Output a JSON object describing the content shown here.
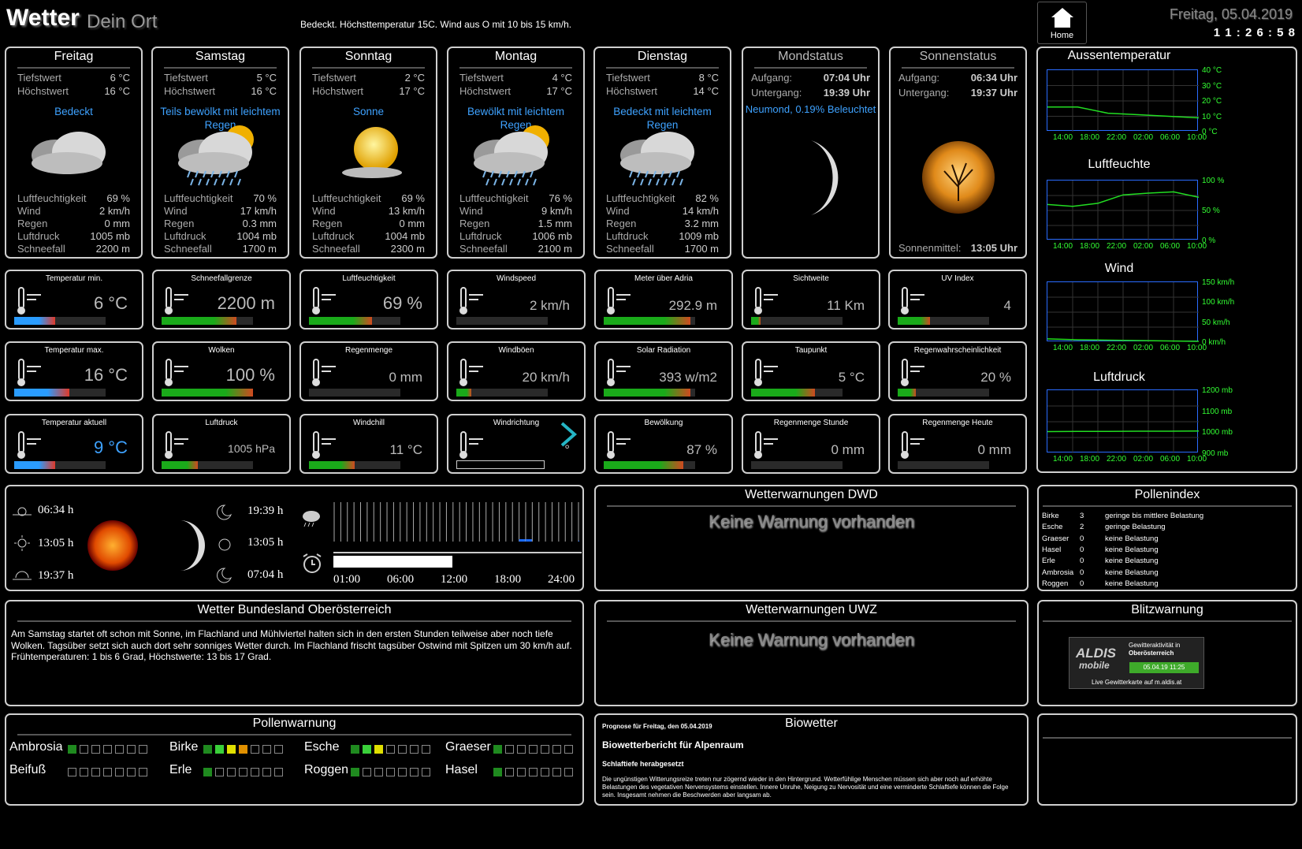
{
  "header": {
    "title": "Wetter",
    "subtitle": "Dein Ort",
    "summary": "Bedeckt. Höchsttemperatur 15C. Wind aus O mit 10 bis 15 km/h.",
    "home_label": "Home",
    "date": "Freitag, 05.04.2019",
    "time": "1 1 : 2 6 : 5 8"
  },
  "forecast": [
    {
      "day": "Freitag",
      "min_label": "Tiefstwert",
      "min": "6 °C",
      "max_label": "Höchstwert",
      "max": "16 °C",
      "desc": "Bedeckt",
      "icon": "cloudy-icon",
      "hum_label": "Luftfeuchtigkeit",
      "hum": "69 %",
      "wind_label": "Wind",
      "wind": "2 km/h",
      "rain_label": "Regen",
      "rain": "0 mm",
      "press_label": "Luftdruck",
      "press": "1005 mb",
      "snow_label": "Schneefall",
      "snow": "2200 m"
    },
    {
      "day": "Samstag",
      "min_label": "Tiefstwert",
      "min": "5 °C",
      "max_label": "Höchstwert",
      "max": "16 °C",
      "desc": "Teils bewölkt mit leichtem Regen",
      "icon": "sun-cloud-rain-icon",
      "hum_label": "Luftfeuchtigkeit",
      "hum": "70 %",
      "wind_label": "Wind",
      "wind": "17 km/h",
      "rain_label": "Regen",
      "rain": "0.3 mm",
      "press_label": "Luftdruck",
      "press": "1004 mb",
      "snow_label": "Schneefall",
      "snow": "1700 m"
    },
    {
      "day": "Sonntag",
      "min_label": "Tiefstwert",
      "min": "2 °C",
      "max_label": "Höchstwert",
      "max": "17 °C",
      "desc": "Sonne",
      "icon": "sun-icon",
      "hum_label": "Luftfeuchtigkeit",
      "hum": "69 %",
      "wind_label": "Wind",
      "wind": "13 km/h",
      "rain_label": "Regen",
      "rain": "0 mm",
      "press_label": "Luftdruck",
      "press": "1004 mb",
      "snow_label": "Schneefall",
      "snow": "2300 m"
    },
    {
      "day": "Montag",
      "min_label": "Tiefstwert",
      "min": "4 °C",
      "max_label": "Höchstwert",
      "max": "17 °C",
      "desc": "Bewölkt mit leichtem Regen",
      "icon": "sun-cloud-rain-icon",
      "hum_label": "Luftfeuchtigkeit",
      "hum": "76 %",
      "wind_label": "Wind",
      "wind": "9 km/h",
      "rain_label": "Regen",
      "rain": "1.5 mm",
      "press_label": "Luftdruck",
      "press": "1006 mb",
      "snow_label": "Schneefall",
      "snow": "2100 m"
    },
    {
      "day": "Dienstag",
      "min_label": "Tiefstwert",
      "min": "8 °C",
      "max_label": "Höchstwert",
      "max": "14 °C",
      "desc": "Bedeckt mit leichtem Regen",
      "icon": "cloud-rain-icon",
      "hum_label": "Luftfeuchtigkeit",
      "hum": "82 %",
      "wind_label": "Wind",
      "wind": "14 km/h",
      "rain_label": "Regen",
      "rain": "3.2 mm",
      "press_label": "Luftdruck",
      "press": "1009 mb",
      "snow_label": "Schneefall",
      "snow": "1700 m"
    }
  ],
  "moon": {
    "title": "Mondstatus",
    "rise_label": "Aufgang:",
    "rise": "07:04 Uhr",
    "set_label": "Untergang:",
    "set": "19:39 Uhr",
    "phase": "Neumond, 0.19% Beleuchtet"
  },
  "sun": {
    "title": "Sonnenstatus",
    "rise_label": "Aufgang:",
    "rise": "06:34 Uhr",
    "set_label": "Untergang:",
    "set": "19:37 Uhr",
    "noon_label": "Sonnenmittel:",
    "noon": "13:05 Uhr"
  },
  "sensors": [
    {
      "title": "Temperatur min.",
      "value": "6 °C",
      "icon": "thermometer-min-icon",
      "level": 0.45,
      "color": "blue"
    },
    {
      "title": "Schneefallgrenze",
      "value": "2200 m",
      "icon": "snowflake-icon",
      "level": 0.82,
      "color": "green"
    },
    {
      "title": "Luftfeuchtigkeit",
      "value": "69 %",
      "icon": "humidity-icon",
      "level": 0.69,
      "color": "green"
    },
    {
      "title": "Windspeed",
      "value": "2 km/h",
      "icon": "windsock-icon",
      "level": 0.0,
      "color": "green"
    },
    {
      "title": "Meter über Adria",
      "value": "292.9 m",
      "icon": "altitude-icon",
      "level": 0.95,
      "color": "green"
    },
    {
      "title": "Sichtweite",
      "value": "11 Km",
      "icon": "visibility-icon",
      "level": 0.1,
      "color": "green"
    },
    {
      "title": "UV Index",
      "value": "4",
      "icon": "uv-index-icon",
      "level": 0.35,
      "color": "green"
    },
    {
      "title": "Temperatur max.",
      "value": "16 °C",
      "icon": "thermometer-max-icon",
      "level": 0.6,
      "color": "blue"
    },
    {
      "title": "Wolken",
      "value": "100 %",
      "icon": "cloud-sun-icon",
      "level": 1.0,
      "color": "green"
    },
    {
      "title": "Regenmenge",
      "value": "0 mm",
      "icon": "rain-icon",
      "level": 0.0,
      "color": "green"
    },
    {
      "title": "Windböen",
      "value": "20 km/h",
      "icon": "windsock-bft-icon",
      "level": 0.16,
      "color": "green"
    },
    {
      "title": "Solar Radiation",
      "value": "393 w/m2",
      "icon": "solar-radiation-icon",
      "level": 0.95,
      "color": "green"
    },
    {
      "title": "Taupunkt",
      "value": "5 °C",
      "icon": "dewpoint-icon",
      "level": 0.7,
      "color": "green"
    },
    {
      "title": "Regenwahrscheinlichkeit",
      "value": "20 %",
      "icon": "rain-probability-icon",
      "level": 0.2,
      "color": "green"
    },
    {
      "title": "Temperatur aktuell",
      "value": "9 °C",
      "icon": "thermometer-icon",
      "level": 0.45,
      "color": "blue"
    },
    {
      "title": "Luftdruck",
      "value": "1005 hPa",
      "icon": "barometer-icon",
      "level": 0.4,
      "color": "green"
    },
    {
      "title": "Windchill",
      "value": "11 °C",
      "icon": "windchill-icon",
      "level": 0.5,
      "color": "green"
    },
    {
      "title": "Windrichtung",
      "value": "°",
      "icon": "wind-direction-icon",
      "level": 0.0,
      "color": "none"
    },
    {
      "title": "Bewölkung",
      "value": "87 %",
      "icon": "cloud-sun-icon",
      "level": 0.87,
      "color": "green"
    },
    {
      "title": "Regenmenge Stunde",
      "value": "0 mm",
      "icon": "rain-icon",
      "level": 0.0,
      "color": "green"
    },
    {
      "title": "Regenmenge Heute",
      "value": "0 mm",
      "icon": "rain-icon",
      "level": 0.0,
      "color": "green"
    }
  ],
  "graphs": [
    {
      "title": "Aussentemperatur",
      "yticks": [
        "40 °C",
        "30 °C",
        "20 °C",
        "10 °C",
        "0 °C"
      ],
      "xticks": [
        "14:00",
        "18:00",
        "22:00",
        "02:00",
        "06:00",
        "10:00"
      ],
      "series": [
        16,
        16,
        12,
        11,
        10,
        9
      ],
      "ymax": 40
    },
    {
      "title": "Luftfeuchte",
      "yticks": [
        "100 %",
        "50 %",
        "0 %"
      ],
      "xticks": [
        "14:00",
        "18:00",
        "22:00",
        "02:00",
        "06:00",
        "10:00"
      ],
      "series": [
        60,
        57,
        62,
        76,
        79,
        81,
        72
      ],
      "ymax": 100
    },
    {
      "title": "Wind",
      "yticks": [
        "150 km/h",
        "100 km/h",
        "50 km/h",
        "0 km/h"
      ],
      "xticks": [
        "14:00",
        "18:00",
        "22:00",
        "02:00",
        "06:00",
        "10:00"
      ],
      "series": [
        8,
        6,
        5,
        4,
        3,
        2
      ],
      "ymax": 150
    },
    {
      "title": "Luftdruck",
      "yticks": [
        "1200 mb",
        "1100 mb",
        "1000 mb",
        "900 mb"
      ],
      "xticks": [
        "14:00",
        "18:00",
        "22:00",
        "02:00",
        "06:00",
        "10:00"
      ],
      "series": [
        1003,
        1004,
        1004,
        1005,
        1005,
        1006
      ],
      "ymin": 900,
      "ymax": 1200
    }
  ],
  "daylight": {
    "sunrise": "06:34 h",
    "noon": "13:05 h",
    "sunset": "19:37 h",
    "moonset": "19:39 h",
    "moon_mid": "13:05 h",
    "moonrise": "07:04 h",
    "ticks": [
      "01:00",
      "06:00",
      "12:00",
      "18:00",
      "24:00"
    ],
    "rain_bars": [
      0,
      0,
      0,
      0,
      0,
      0,
      0,
      0,
      0,
      0,
      0,
      0,
      0,
      0,
      0,
      0,
      0,
      0,
      0,
      0,
      0,
      0,
      0,
      0,
      0,
      0,
      0,
      0,
      0.05,
      0.05,
      0,
      0,
      0,
      0,
      0,
      0,
      0,
      0.02
    ],
    "day_progress": 0.48
  },
  "dwd": {
    "title": "Wetterwarnungen DWD",
    "text": "Keine Warnung vorhanden"
  },
  "uwz": {
    "title": "Wetterwarnungen UWZ",
    "text": "Keine Warnung vorhanden"
  },
  "pollenindex": {
    "title": "Pollenindex",
    "rows": [
      {
        "name": "Birke",
        "val": "3",
        "text": "geringe bis mittlere Belastung"
      },
      {
        "name": "Esche",
        "val": "2",
        "text": "geringe Belastung"
      },
      {
        "name": "Graeser",
        "val": "0",
        "text": "keine Belastung"
      },
      {
        "name": "Hasel",
        "val": "0",
        "text": "keine Belastung"
      },
      {
        "name": "Erle",
        "val": "0",
        "text": "keine Belastung"
      },
      {
        "name": "Ambrosia",
        "val": "0",
        "text": "keine Belastung"
      },
      {
        "name": "Roggen",
        "val": "0",
        "text": "keine Belastung"
      }
    ]
  },
  "bundesland": {
    "title": "Wetter Bundesland Oberösterreich",
    "text": "Am Samstag startet oft schon mit Sonne, im Flachland und Mühlviertel halten sich in den ersten Stunden teilweise aber noch tiefe Wolken. Tagsüber setzt sich auch dort sehr sonniges Wetter durch. Im Flachland frischt tagsüber Ostwind mit Spitzen um 30 km/h auf. Frühtemperaturen: 1 bis 6 Grad, Höchstwerte: 13 bis 17 Grad."
  },
  "blitz": {
    "title": "Blitzwarnung",
    "brand": "ALDIS",
    "brand2": "mobile",
    "text1": "Gewitteraktivität in",
    "text2": "Oberösterreich",
    "stamp": "05.04.19 11:25",
    "footer": "Live Gewitterkarte auf m.aldis.at"
  },
  "pollenwarnung": {
    "title": "Pollenwarnung",
    "items": [
      {
        "name": "Ambrosia",
        "level": 1
      },
      {
        "name": "Birke",
        "level": 4
      },
      {
        "name": "Esche",
        "level": 3
      },
      {
        "name": "Graeser",
        "level": 1
      },
      {
        "name": "Beifuß",
        "level": 0
      },
      {
        "name": "Erle",
        "level": 1
      },
      {
        "name": "Roggen",
        "level": 1
      },
      {
        "name": "Hasel",
        "level": 1
      }
    ]
  },
  "biowetter": {
    "title": "Biowetter",
    "forecast": "Prognose für Freitag, den 05.04.2019",
    "heading": "Biowetterbericht für Alpenraum",
    "sub": "Schlaftiefe herabgesetzt",
    "text": "Die ungünstigen Witterungsreize treten nur zögernd wieder in den Hintergrund. Wetterfühlige Menschen müssen sich aber noch auf erhöhte Belastungen des vegetativen Nervensystems einstellen. Innere Unruhe, Neigung zu Nervosität und eine verminderte Schlaftiefe können die Folge sein. Insgesamt nehmen die Beschwerden aber langsam ab."
  }
}
